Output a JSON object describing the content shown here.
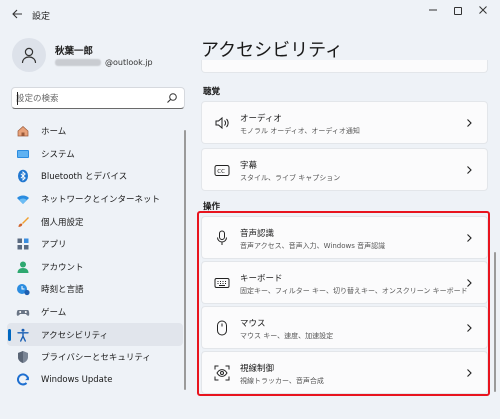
{
  "app": {
    "title": "設定"
  },
  "profile": {
    "name": "秋葉一郎",
    "email_domain": "@outlook.jp"
  },
  "search": {
    "placeholder": "設定の検索",
    "value": ""
  },
  "sidebar": {
    "items": [
      {
        "label": "ホーム",
        "icon": "home-icon"
      },
      {
        "label": "システム",
        "icon": "system-icon"
      },
      {
        "label": "Bluetooth とデバイス",
        "icon": "bluetooth-icon"
      },
      {
        "label": "ネットワークとインターネット",
        "icon": "wifi-icon"
      },
      {
        "label": "個人用設定",
        "icon": "brush-icon"
      },
      {
        "label": "アプリ",
        "icon": "apps-icon"
      },
      {
        "label": "アカウント",
        "icon": "account-icon"
      },
      {
        "label": "時刻と言語",
        "icon": "time-language-icon"
      },
      {
        "label": "ゲーム",
        "icon": "gaming-icon"
      },
      {
        "label": "アクセシビリティ",
        "icon": "accessibility-icon",
        "selected": true
      },
      {
        "label": "プライバシーとセキュリティ",
        "icon": "shield-icon"
      },
      {
        "label": "Windows Update",
        "icon": "windows-update-icon"
      }
    ]
  },
  "main": {
    "title": "アクセシビリティ",
    "sections": [
      {
        "label": "聴覚",
        "cards": [
          {
            "title": "オーディオ",
            "desc": "モノラル オーディオ、オーディオ通知",
            "icon": "speaker-icon"
          },
          {
            "title": "字幕",
            "desc": "スタイル、ライブ キャプション",
            "icon": "captions-icon"
          }
        ]
      },
      {
        "label": "操作",
        "cards": [
          {
            "title": "音声認識",
            "desc": "音声アクセス、音声入力、Windows 音声認識",
            "icon": "microphone-icon"
          },
          {
            "title": "キーボード",
            "desc": "固定キー、フィルター キー、切り替えキー、オンスクリーン キーボード",
            "icon": "keyboard-icon"
          },
          {
            "title": "マウス",
            "desc": "マウス キー、速度、加速設定",
            "icon": "mouse-icon"
          },
          {
            "title": "視線制御",
            "desc": "視線トラッカー、音声合成",
            "icon": "eye-control-icon"
          }
        ]
      }
    ]
  },
  "colors": {
    "accent": "#0067c0",
    "highlight": "#e8141e",
    "background": "#eef2f7",
    "card": "#fbfbfc"
  }
}
